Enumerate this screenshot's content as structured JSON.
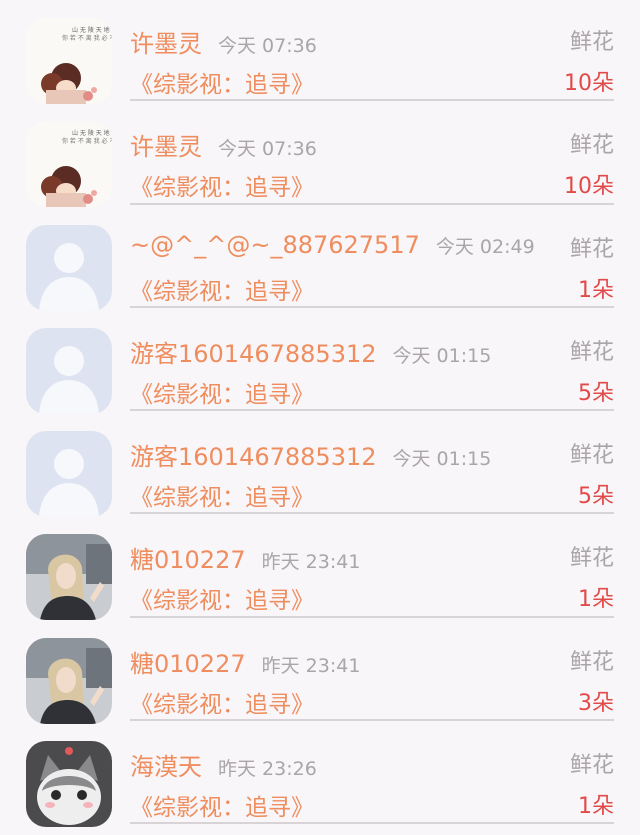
{
  "rows": [
    {
      "name": "许墨灵",
      "time": "今天 07:36",
      "book": "《综影视：追寻》",
      "gift": "鲜花",
      "count": "10朵",
      "avatar": "couple-illustration-avatar"
    },
    {
      "name": "许墨灵",
      "time": "今天 07:36",
      "book": "《综影视：追寻》",
      "gift": "鲜花",
      "count": "10朵",
      "avatar": "couple-illustration-avatar"
    },
    {
      "name": "~@^_^@~_887627517",
      "time": "今天 02:49",
      "book": "《综影视：追寻》",
      "gift": "鲜花",
      "count": "1朵",
      "avatar": "default-user-avatar"
    },
    {
      "name": "游客1601467885312",
      "time": "今天 01:15",
      "book": "《综影视：追寻》",
      "gift": "鲜花",
      "count": "5朵",
      "avatar": "default-user-avatar"
    },
    {
      "name": "游客1601467885312",
      "time": "今天 01:15",
      "book": "《综影视：追寻》",
      "gift": "鲜花",
      "count": "5朵",
      "avatar": "default-user-avatar"
    },
    {
      "name": "糖010227",
      "time": "昨天 23:41",
      "book": "《综影视：追寻》",
      "gift": "鲜花",
      "count": "1朵",
      "avatar": "girl-photo-avatar"
    },
    {
      "name": "糖010227",
      "time": "昨天 23:41",
      "book": "《综影视：追寻》",
      "gift": "鲜花",
      "count": "3朵",
      "avatar": "girl-photo-avatar"
    },
    {
      "name": "海漠天",
      "time": "昨天 23:26",
      "book": "《综影视：追寻》",
      "gift": "鲜花",
      "count": "1朵",
      "avatar": "kitten-photo-avatar"
    }
  ]
}
